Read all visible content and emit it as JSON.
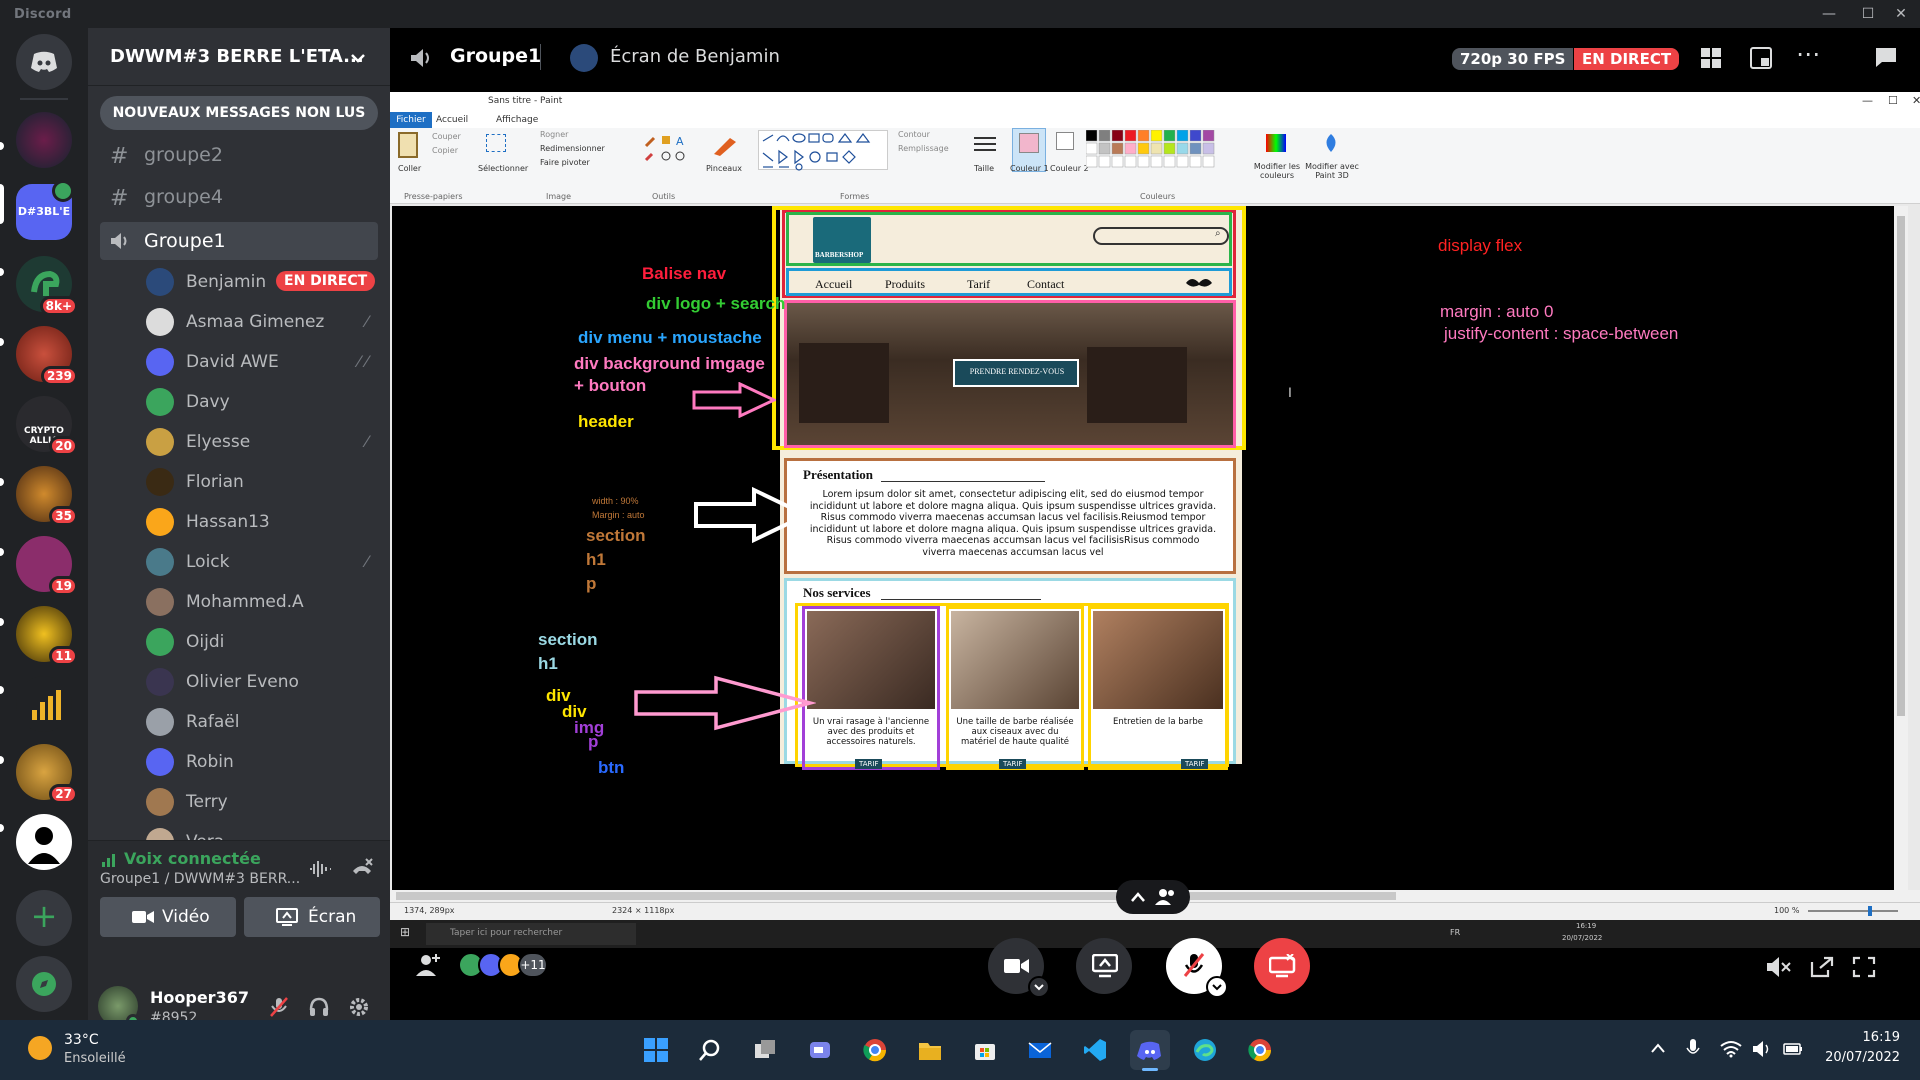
{
  "window": {
    "app_title": "Discord",
    "minimize": "—",
    "maximize": "☐",
    "close": "✕"
  },
  "servers": {
    "badges": [
      "8k+",
      "239",
      "20",
      "35",
      "19",
      "11",
      "27"
    ],
    "active_label": "D#3BL'E",
    "crypto_label": "CRYPTO ALLIA"
  },
  "guild": {
    "name": "DWWM#3 BERRE L'ETA...",
    "new_messages": "NOUVEAUX MESSAGES NON LUS"
  },
  "channels": [
    {
      "icon": "#",
      "name": "groupe2"
    },
    {
      "icon": "#",
      "name": "groupe4"
    },
    {
      "icon": "speaker",
      "name": "Groupe1"
    }
  ],
  "voice_users": [
    {
      "name": "Benjamin",
      "badge": "EN DIRECT"
    },
    {
      "name": "Asmaa Gimenez"
    },
    {
      "name": "David AWE"
    },
    {
      "name": "Davy"
    },
    {
      "name": "Elyesse"
    },
    {
      "name": "Florian"
    },
    {
      "name": "Hassan13"
    },
    {
      "name": "Loick"
    },
    {
      "name": "Mohammed.A"
    },
    {
      "name": "Oijdi"
    },
    {
      "name": "Olivier Eveno"
    },
    {
      "name": "Rafaël"
    },
    {
      "name": "Robin"
    },
    {
      "name": "Terry"
    },
    {
      "name": "Vera"
    }
  ],
  "voice": {
    "status": "Voix connectée",
    "channel": "Groupe1 / DWWM#3 BERR...",
    "video_btn": "Vidéo",
    "screen_btn": "Écran"
  },
  "user": {
    "name": "Hooper367",
    "tag": "#8952"
  },
  "stage": {
    "channel": "Groupe1",
    "stream_title": "Écran de Benjamin",
    "quality": "720p 30 FPS",
    "live": "EN DIRECT",
    "participants_more": "+11"
  },
  "paint": {
    "title": "Sans titre - Paint",
    "tabs": [
      "Fichier",
      "Accueil",
      "Affichage"
    ],
    "clipboard": {
      "paste": "Coller",
      "cut": "Couper",
      "copy": "Copier",
      "group": "Presse-papiers"
    },
    "image": {
      "select": "Sélectionner",
      "crop": "Rogner",
      "resize": "Redimensionner",
      "rotate": "Faire pivoter",
      "group": "Image"
    },
    "tools": {
      "group": "Outils",
      "brushes": "Pinceaux"
    },
    "shapes": {
      "group": "Formes",
      "outline": "Contour",
      "fill": "Remplissage",
      "size": "Taille"
    },
    "colors": {
      "color1": "Couleur 1",
      "color2": "Couleur 2",
      "group": "Couleurs",
      "edit": "Modifier les couleurs",
      "paint3d": "Modifier avec Paint 3D"
    },
    "status": {
      "pos": "1374, 289px",
      "size": "2324 × 1118px",
      "zoom": "100 %"
    }
  },
  "annotations": {
    "nav": "Balise nav",
    "logo": "div logo + search",
    "menu": "div menu + moustache",
    "bg": "div background imgage",
    "bg2": "+ bouton",
    "header": "header",
    "flex": "display flex",
    "margin": "margin : auto 0",
    "justify": "justify-content : space-between",
    "width": "width : 90%",
    "margin2": "Margin : auto",
    "section": "section",
    "h1": "h1",
    "p": "p",
    "section2": "section",
    "h1b": "h1",
    "div": "div",
    "div2": "div",
    "img": "img",
    "p2": "p",
    "btn": "btn"
  },
  "mockup": {
    "brand": "BARBERSHOP",
    "menu": [
      "Accueil",
      "Produits",
      "Tarif",
      "Contact"
    ],
    "cta": "PRENDRE RENDEZ-VOUS",
    "presentation_title": "Présentation",
    "presentation_text": "Lorem ipsum dolor sit amet, consectetur adipiscing elit, sed do eiusmod tempor incididunt ut labore et dolore magna aliqua. Quis ipsum suspendisse ultrices gravida. Risus commodo viverra maecenas accumsan lacus vel facilisis.Reiusmod tempor incididunt ut labore et dolore magna aliqua. Quis ipsum suspendisse ultrices gravida. Risus commodo viverra maecenas accumsan lacus vel facilisisRisus commodo viverra maecenas accumsan lacus vel",
    "services_title": "Nos services",
    "services": [
      "Un vrai rasage à l'ancienne avec des produits et accessoires naturels.",
      "Une taille de barbe réalisée aux ciseaux avec du matériel de haute qualité",
      "Entretien de la barbe"
    ],
    "service_btn": "TARIF"
  },
  "win_taskbar": {
    "search": "Taper ici pour rechercher",
    "lang": "FR",
    "time_small": "16:19",
    "date_small": "20/07/2022"
  },
  "taskbar": {
    "temp": "33°C",
    "weather": "Ensoleillé",
    "time": "16:19",
    "date": "20/07/2022"
  }
}
